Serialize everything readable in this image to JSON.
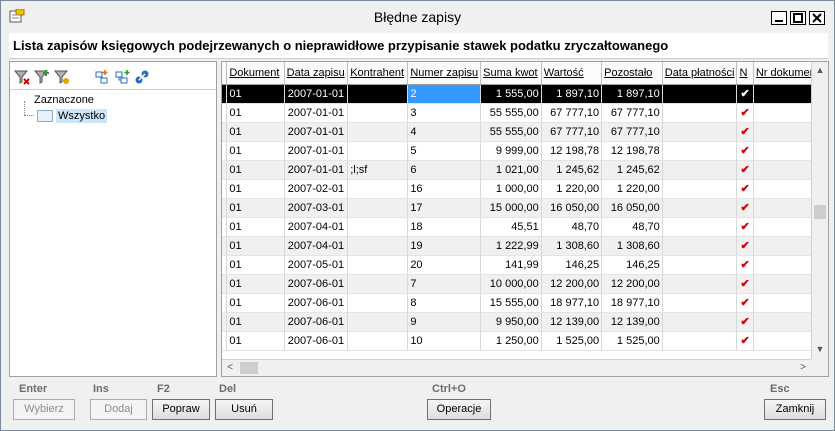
{
  "window": {
    "title": "Błędne zapisy"
  },
  "header": {
    "title": "Lista zapisów księgowych podejrzewanych o nieprawidłowe przypisanie stawek podatku zryczałtowanego"
  },
  "toolbar": {
    "icons": [
      "filter-remove-icon",
      "filter-add-icon",
      "filter-edit-icon",
      "tree-add-icon",
      "tree-add-child-icon",
      "tree-link-icon"
    ]
  },
  "tree": {
    "root_label": "Zaznaczone",
    "child_label": "Wszystko"
  },
  "table": {
    "columns": [
      "Dokument",
      "Data zapisu",
      "Kontrahent",
      "Numer zapisu",
      "Suma kwot",
      "Wartość",
      "Pozostało",
      "Data płatności",
      "N",
      "Nr dokumentu"
    ],
    "rows": [
      [
        "01",
        "2007-01-01",
        "",
        "2",
        "1 555,00",
        "1 897,10",
        "1 897,10",
        "",
        "✔",
        ""
      ],
      [
        "01",
        "2007-01-01",
        "",
        "3",
        "55 555,00",
        "67 777,10",
        "67 777,10",
        "",
        "✔",
        ""
      ],
      [
        "01",
        "2007-01-01",
        "",
        "4",
        "55 555,00",
        "67 777,10",
        "67 777,10",
        "",
        "✔",
        ""
      ],
      [
        "01",
        "2007-01-01",
        "",
        "5",
        "9 999,00",
        "12 198,78",
        "12 198,78",
        "",
        "✔",
        ""
      ],
      [
        "01",
        "2007-01-01",
        ";l;sf",
        "6",
        "1 021,00",
        "1 245,62",
        "1 245,62",
        "",
        "✔",
        ""
      ],
      [
        "01",
        "2007-02-01",
        "",
        "16",
        "1 000,00",
        "1 220,00",
        "1 220,00",
        "",
        "✔",
        ""
      ],
      [
        "01",
        "2007-03-01",
        "",
        "17",
        "15 000,00",
        "16 050,00",
        "16 050,00",
        "",
        "✔",
        ""
      ],
      [
        "01",
        "2007-04-01",
        "",
        "18",
        "45,51",
        "48,70",
        "48,70",
        "",
        "✔",
        ""
      ],
      [
        "01",
        "2007-04-01",
        "",
        "19",
        "1 222,99",
        "1 308,60",
        "1 308,60",
        "",
        "✔",
        ""
      ],
      [
        "01",
        "2007-05-01",
        "",
        "20",
        "141,99",
        "146,25",
        "146,25",
        "",
        "✔",
        ""
      ],
      [
        "01",
        "2007-06-01",
        "",
        "7",
        "10 000,00",
        "12 200,00",
        "12 200,00",
        "",
        "✔",
        ""
      ],
      [
        "01",
        "2007-06-01",
        "",
        "8",
        "15 555,00",
        "18 977,10",
        "18 977,10",
        "",
        "✔",
        ""
      ],
      [
        "01",
        "2007-06-01",
        "",
        "9",
        "9 950,00",
        "12 139,00",
        "12 139,00",
        "",
        "✔",
        ""
      ],
      [
        "01",
        "2007-06-01",
        "",
        "10",
        "1 250,00",
        "1 525,00",
        "1 525,00",
        "",
        "✔",
        ""
      ]
    ],
    "selected_row": 0
  },
  "scroll": {
    "left_arrow": "<",
    "right_arrow": ">",
    "up_arrow": "▲",
    "down_arrow": "▼"
  },
  "actions": {
    "select": {
      "hotkey": "Enter",
      "label": "Wybierz"
    },
    "add": {
      "hotkey": "Ins",
      "label": "Dodaj"
    },
    "edit": {
      "hotkey": "F2",
      "label": "Popraw"
    },
    "delete": {
      "hotkey": "Del",
      "label": "Usuń"
    },
    "operations": {
      "hotkey": "Ctrl+O",
      "label": "Operacje"
    },
    "close": {
      "hotkey": "Esc",
      "label": "Zamknij"
    }
  }
}
